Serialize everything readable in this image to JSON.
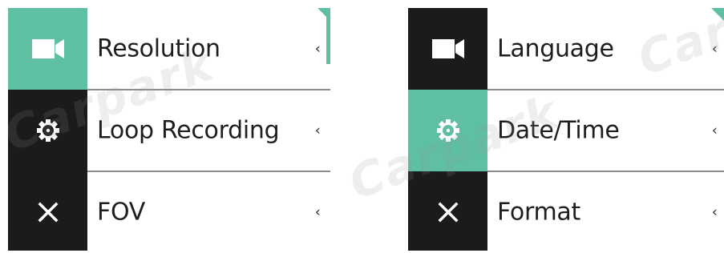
{
  "theme": {
    "accent": "#5fbfa3",
    "rail": "#1b1b1b"
  },
  "left_panel": {
    "rows": [
      {
        "label": "Resolution",
        "icon": "video-camera-icon",
        "active": true
      },
      {
        "label": "Loop Recording",
        "icon": "gear-icon",
        "active": false
      },
      {
        "label": "FOV",
        "icon": "close-icon",
        "active": false
      }
    ],
    "chevron": "‹"
  },
  "right_panel": {
    "rows": [
      {
        "label": "Language",
        "icon": "video-camera-icon",
        "active": false
      },
      {
        "label": "Date/Time",
        "icon": "gear-icon",
        "active": true
      },
      {
        "label": "Format",
        "icon": "close-icon",
        "active": false
      }
    ],
    "chevron": "‹"
  },
  "watermark": {
    "text": "Carpark"
  }
}
